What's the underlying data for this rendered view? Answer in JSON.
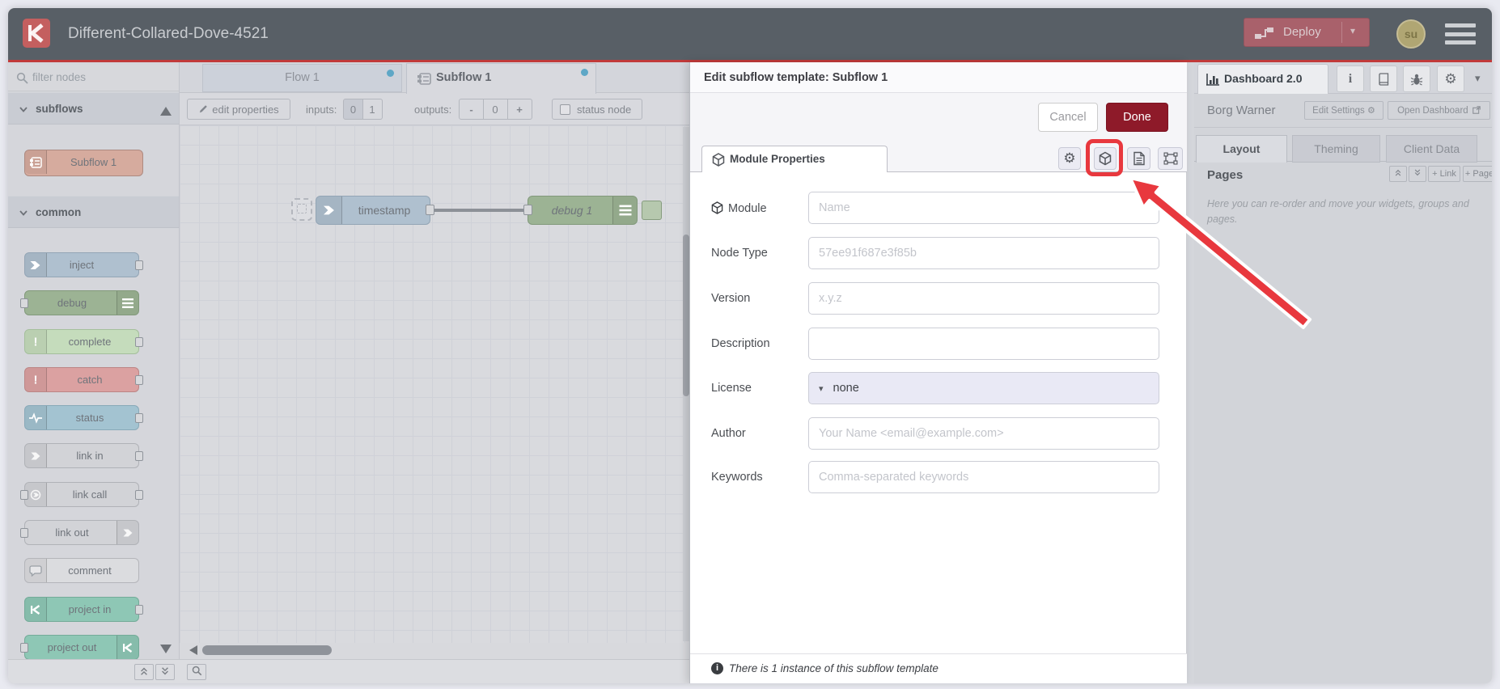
{
  "window": {
    "title": "Different-Collared-Dove-4521"
  },
  "header": {
    "deploy_label": "Deploy",
    "avatar_initials": "su"
  },
  "palette": {
    "filter_placeholder": "filter nodes",
    "categories": [
      {
        "label": "subflows",
        "items": [
          "Subflow 1"
        ]
      },
      {
        "label": "common",
        "items": [
          "inject",
          "debug",
          "complete",
          "catch",
          "status",
          "link in",
          "link call",
          "link out",
          "comment",
          "project in",
          "project out"
        ]
      }
    ]
  },
  "workspace": {
    "tabs": [
      {
        "label": "Flow 1"
      },
      {
        "label": "Subflow 1"
      }
    ],
    "toolbar": {
      "edit_properties": "edit properties",
      "inputs_label": "inputs:",
      "input_options": [
        "0",
        "1"
      ],
      "outputs_label": "outputs:",
      "minus": "-",
      "outputs_value": "0",
      "plus": "+",
      "status_node": "status node"
    },
    "nodes": [
      {
        "label": "timestamp"
      },
      {
        "label": "debug 1"
      }
    ]
  },
  "dialog": {
    "title": "Edit subflow template: Subflow 1",
    "cancel_label": "Cancel",
    "done_label": "Done",
    "tab_label": "Module Properties",
    "fields": [
      {
        "label": "Module",
        "placeholder": "Name"
      },
      {
        "label": "Node Type",
        "placeholder": "57ee91f687e3f85b"
      },
      {
        "label": "Version",
        "placeholder": "x.y.z"
      },
      {
        "label": "Description",
        "placeholder": ""
      },
      {
        "label": "License",
        "value": "none"
      },
      {
        "label": "Author",
        "placeholder": "Your Name <email@example.com>"
      },
      {
        "label": "Keywords",
        "placeholder": "Comma-separated keywords"
      }
    ],
    "footer_note": "There is 1 instance of this subflow template"
  },
  "sidebar": {
    "tab_label": "Dashboard 2.0",
    "section_title": "Borg Warner",
    "edit_settings": "Edit Settings",
    "open_dashboard": "Open Dashboard",
    "tabs": [
      "Layout",
      "Theming",
      "Client Data"
    ],
    "pages_title": "Pages",
    "link_button": "+ Link",
    "page_button": "+ Page",
    "help_text": "Here you can re-order and move your widgets, groups and pages."
  },
  "colors": {
    "header_red_line": "#c13a3a",
    "deploy_button": "#a9616b",
    "done_button": "#8e1a29",
    "annotation_red": "#e8383e",
    "tab_dot_blue": "#5ea7c6",
    "node_inject": "#afc0cf",
    "node_debug": "#9cb394",
    "node_subflow": "#d6ab9e"
  }
}
